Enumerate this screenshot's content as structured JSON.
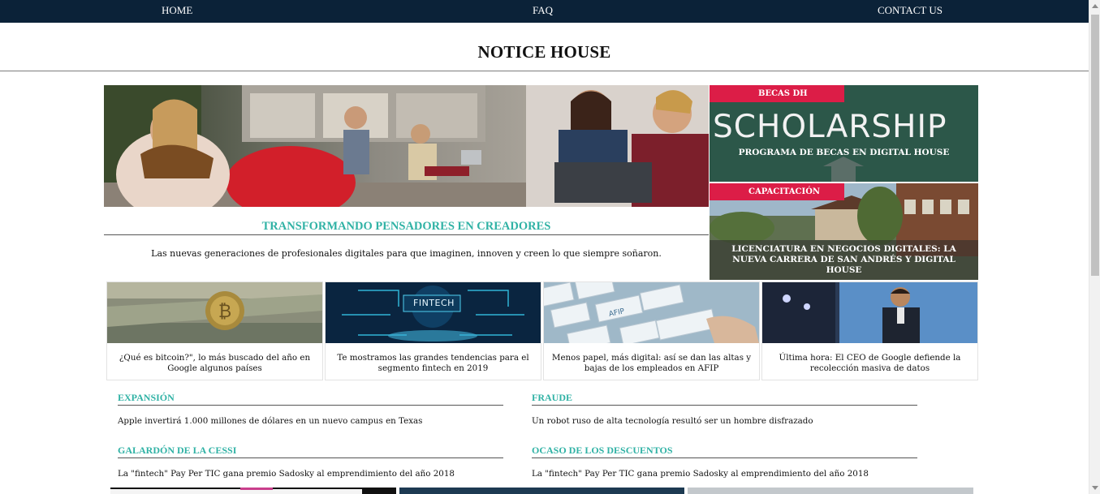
{
  "nav": {
    "home": "HOME",
    "faq": "FAQ",
    "contact": "CONTACT US"
  },
  "site": {
    "title": "NOTICE HOUSE"
  },
  "hero": {
    "headline": "TRANSFORMANDO PENSADORES EN CREADORES",
    "subtitle": "Las nuevas generaciones de profesionales digitales para que imaginen, innoven y creen lo que siempre soñaron."
  },
  "side_cards": [
    {
      "badge": "BECAS DH",
      "image_text": "SCHOLARSHIP",
      "caption": "PROGRAMA DE BECAS EN DIGITAL HOUSE"
    },
    {
      "badge": "CAPACITACIÓN",
      "caption": "LICENCIATURA EN NEGOCIOS DIGITALES: LA NUEVA CARRERA DE SAN ANDRÉS Y DIGITAL HOUSE"
    }
  ],
  "grid": [
    {
      "caption": "¿Qué es bitcoin?\", lo más buscado del año en Google algunos países",
      "image": "bitcoin-coin"
    },
    {
      "caption": "Te mostramos las grandes tendencias para el segmento fintech en 2019",
      "image": "fintech-circuit",
      "image_text": "FINTECH"
    },
    {
      "caption": "Menos papel, más digital: así se dan las altas y bajas de los empleados en AFIP",
      "image": "keyboard",
      "image_text": "AFIP"
    },
    {
      "caption": "Última hora: El CEO de Google defiende la recolección masiva de datos",
      "image": "speaker-on-stage"
    }
  ],
  "sections": [
    {
      "heading": "EXPANSIÓN",
      "text": "Apple invertirá 1.000 millones de dólares en un nuevo campus en Texas"
    },
    {
      "heading": "FRAUDE",
      "text": "Un robot ruso de alta tecnología resultó ser un hombre disfrazado"
    },
    {
      "heading": "GALARDÓN DE LA CESSI",
      "text": "La \"fintech\" Pay Per TIC gana premio Sadosky al emprendimiento del año 2018"
    },
    {
      "heading": "OCASO DE LOS DESCUENTOS",
      "text": "La \"fintech\" Pay Per TIC gana premio Sadosky al emprendimiento del año 2018"
    }
  ],
  "colors": {
    "nav_bg": "#0b2238",
    "accent_teal": "#30b2a5",
    "badge_red": "#dc1d47"
  }
}
